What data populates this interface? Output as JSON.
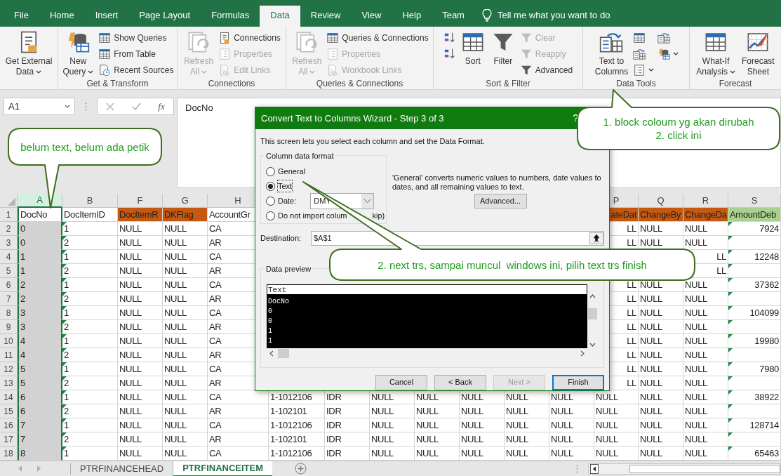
{
  "ribbon": {
    "tabs": [
      {
        "label": "File",
        "selected": false
      },
      {
        "label": "Home",
        "selected": false
      },
      {
        "label": "Insert",
        "selected": false
      },
      {
        "label": "Page Layout",
        "selected": false
      },
      {
        "label": "Formulas",
        "selected": false
      },
      {
        "label": "Data",
        "selected": true
      },
      {
        "label": "Review",
        "selected": false
      },
      {
        "label": "View",
        "selected": false
      },
      {
        "label": "Help",
        "selected": false
      },
      {
        "label": "Team",
        "selected": false
      }
    ],
    "tell_me": "Tell me what you want to do",
    "groups": [
      {
        "columns": [
          {
            "kind": "large",
            "lines": [
              "Get External",
              "Data"
            ],
            "dropdown": true,
            "disabled": false
          }
        ]
      },
      {
        "label": "Get & Transform",
        "columns": [
          {
            "kind": "large",
            "lines": [
              "New",
              "Query"
            ],
            "dropdown": true,
            "disabled": false
          },
          {
            "kind": "stack",
            "items": [
              {
                "label": "Show Queries",
                "disabled": false
              },
              {
                "label": "From Table",
                "disabled": false
              },
              {
                "label": "Recent Sources",
                "disabled": false
              }
            ]
          }
        ]
      },
      {
        "label": "Connections",
        "columns": [
          {
            "kind": "large",
            "lines": [
              "Refresh",
              "All"
            ],
            "dropdown": true,
            "disabled": true
          },
          {
            "kind": "stack",
            "items": [
              {
                "label": "Connections",
                "disabled": false
              },
              {
                "label": "Properties",
                "disabled": true
              },
              {
                "label": "Edit Links",
                "disabled": true
              }
            ]
          }
        ]
      },
      {
        "label": "Queries & Connections",
        "columns": [
          {
            "kind": "large",
            "lines": [
              "Refresh",
              "All"
            ],
            "dropdown": true,
            "disabled": true
          },
          {
            "kind": "stack",
            "items": [
              {
                "label": "Queries & Connections",
                "disabled": false
              },
              {
                "label": "Properties",
                "disabled": true
              },
              {
                "label": "Workbook Links",
                "disabled": true
              }
            ]
          }
        ]
      },
      {
        "label": "Sort & Filter",
        "columns": [
          {
            "kind": "stack",
            "items": [
              {
                "disabled": false
              },
              {
                "disabled": false
              }
            ]
          },
          {
            "kind": "large",
            "lines": [
              "Sort"
            ],
            "dropdown": false,
            "disabled": false
          },
          {
            "kind": "large",
            "lines": [
              "Filter"
            ],
            "dropdown": false,
            "disabled": false
          },
          {
            "kind": "stack",
            "items": [
              {
                "label": "Clear",
                "disabled": true
              },
              {
                "label": "Reapply",
                "disabled": true
              },
              {
                "label": "Advanced",
                "disabled": false
              }
            ]
          }
        ]
      },
      {
        "label": "Data Tools",
        "columns": [
          {
            "kind": "large",
            "lines": [
              "Text to",
              "Columns"
            ],
            "dropdown": false,
            "disabled": false
          },
          {
            "kind": "stack",
            "items": [
              {
                "disabled": false,
                "dropdown": false
              },
              {
                "disabled": false,
                "dropdown": false
              },
              {
                "disabled": false,
                "dropdown": true
              }
            ]
          },
          {
            "kind": "stack",
            "items": [
              {
                "disabled": false,
                "dropdown": false
              },
              {
                "disabled": false,
                "dropdown": true
              }
            ]
          }
        ]
      },
      {
        "label": "Forecast",
        "columns": [
          {
            "kind": "large",
            "lines": [
              "What-If",
              "Analysis"
            ],
            "dropdown": true,
            "disabled": false
          },
          {
            "kind": "large",
            "lines": [
              "Forecast",
              "Sheet"
            ],
            "dropdown": false,
            "disabled": false
          }
        ]
      }
    ]
  },
  "formula_bar": {
    "name_box": "A1",
    "fx": "fx",
    "value": "DocNo"
  },
  "grid": {
    "columns": [
      {
        "letter": "A",
        "selected": true
      },
      {
        "letter": "B",
        "selected": false,
        "flagged": true
      },
      {
        "letter": "F",
        "selected": false,
        "color": "#c65911"
      },
      {
        "letter": "G",
        "selected": false,
        "color": "#c65911"
      },
      {
        "letter": "H",
        "selected": false
      },
      {
        "selected": false
      },
      {
        "selected": false
      },
      {
        "selected": false
      },
      {
        "selected": false
      },
      {
        "selected": false
      },
      {
        "selected": false
      },
      {
        "selected": false
      },
      {
        "letter": "P",
        "selected": false,
        "color": "#c65911"
      },
      {
        "letter": "Q",
        "selected": false,
        "color": "#c65911"
      },
      {
        "letter": "R",
        "selected": false,
        "color": "#c65911"
      },
      {
        "letter": "S",
        "selected": false,
        "color": "#a9d08e",
        "flagged": true,
        "kind": "numeric"
      }
    ],
    "rows": [
      {
        "number": "1",
        "cells": [
          "DocNo",
          "DocItemID",
          "DocItemR",
          "DKFlag",
          "AccountGr",
          null,
          null,
          null,
          null,
          null,
          null,
          null,
          {
            "text": "ateDat",
            "kind": "clipped"
          },
          "ChangeBy",
          "ChangeDa",
          "AmountDeb"
        ]
      },
      {
        "number": "2",
        "cells": [
          "0",
          "1",
          "NULL",
          "NULL",
          "CA",
          null,
          null,
          null,
          null,
          null,
          null,
          null,
          {
            "text": "LL",
            "kind": "clipped"
          },
          "NULL",
          "NULL",
          "7924"
        ]
      },
      {
        "number": "3",
        "cells": [
          "0",
          "2",
          "NULL",
          "NULL",
          "AR",
          null,
          null,
          null,
          null,
          null,
          null,
          null,
          {
            "text": "LL",
            "kind": "clipped"
          },
          "NULL",
          "NULL",
          null
        ]
      },
      {
        "number": "4",
        "cells": [
          "1",
          "1",
          "NULL",
          "NULL",
          "CA",
          null,
          null,
          null,
          null,
          null,
          null,
          null,
          null,
          null,
          {
            "text": "LL",
            "kind": "clipped"
          },
          "12248"
        ]
      },
      {
        "number": "5",
        "cells": [
          "1",
          "2",
          "NULL",
          "NULL",
          "AR",
          null,
          null,
          null,
          null,
          null,
          null,
          null,
          null,
          null,
          {
            "text": "LL",
            "kind": "clipped"
          },
          null
        ]
      },
      {
        "number": "6",
        "cells": [
          "2",
          "1",
          "NULL",
          "NULL",
          "CA",
          null,
          null,
          null,
          null,
          null,
          null,
          null,
          {
            "text": "LL",
            "kind": "clipped"
          },
          "NULL",
          "NULL",
          "37362"
        ]
      },
      {
        "number": "7",
        "cells": [
          "2",
          "2",
          "NULL",
          "NULL",
          "AR",
          null,
          null,
          null,
          null,
          null,
          null,
          null,
          {
            "text": "LL",
            "kind": "clipped"
          },
          "NULL",
          "NULL",
          null
        ]
      },
      {
        "number": "8",
        "cells": [
          "3",
          "1",
          "NULL",
          "NULL",
          "CA",
          null,
          null,
          null,
          null,
          null,
          null,
          null,
          {
            "text": "LL",
            "kind": "clipped"
          },
          "NULL",
          "NULL",
          "104099"
        ]
      },
      {
        "number": "9",
        "cells": [
          "3",
          "2",
          "NULL",
          "NULL",
          "AR",
          null,
          null,
          null,
          null,
          null,
          null,
          null,
          {
            "text": "LL",
            "kind": "clipped"
          },
          "NULL",
          "NULL",
          null
        ]
      },
      {
        "number": "10",
        "cells": [
          "4",
          "1",
          "NULL",
          "NULL",
          "CA",
          null,
          null,
          null,
          null,
          null,
          null,
          null,
          {
            "text": "LL",
            "kind": "clipped"
          },
          "NULL",
          "NULL",
          "19980"
        ]
      },
      {
        "number": "11",
        "cells": [
          "4",
          "2",
          "NULL",
          "NULL",
          "AR",
          null,
          null,
          null,
          null,
          null,
          null,
          null,
          {
            "text": "LL",
            "kind": "clipped"
          },
          "NULL",
          "NULL",
          null
        ]
      },
      {
        "number": "12",
        "cells": [
          "5",
          "1",
          "NULL",
          "NULL",
          "CA",
          null,
          null,
          null,
          null,
          null,
          null,
          null,
          {
            "text": "LL",
            "kind": "clipped"
          },
          "NULL",
          "NULL",
          "7980"
        ]
      },
      {
        "number": "13",
        "cells": [
          "5",
          "2",
          "NULL",
          "NULL",
          "AR",
          null,
          null,
          null,
          null,
          null,
          null,
          null,
          {
            "text": "LL",
            "kind": "clipped"
          },
          "NULL",
          "NULL",
          null
        ]
      },
      {
        "number": "14",
        "cells": [
          "6",
          "1",
          "NULL",
          "NULL",
          "CA",
          "1-1012106",
          "IDR",
          "NULL",
          "NULL",
          "NULL",
          "NULL",
          "NULL",
          "NULL",
          "NULL",
          "NULL",
          "38922"
        ]
      },
      {
        "number": "15",
        "cells": [
          "6",
          "2",
          "NULL",
          "NULL",
          "AR",
          "1-102101",
          "IDR",
          "NULL",
          "NULL",
          "NULL",
          "NULL",
          "NULL",
          "NULL",
          "NULL",
          "NULL",
          null
        ]
      },
      {
        "number": "16",
        "cells": [
          "7",
          "1",
          "NULL",
          "NULL",
          "CA",
          "1-1012106",
          "IDR",
          "NULL",
          "NULL",
          "NULL",
          "NULL",
          "NULL",
          "NULL",
          "NULL",
          "NULL",
          "128714"
        ]
      },
      {
        "number": "17",
        "cells": [
          "7",
          "2",
          "NULL",
          "NULL",
          "AR",
          "1-102101",
          "IDR",
          "NULL",
          "NULL",
          "NULL",
          "NULL",
          "NULL",
          "NULL",
          "NULL",
          "NULL",
          null
        ]
      },
      {
        "number": "18",
        "cells": [
          "8",
          "1",
          "NULL",
          "NULL",
          "CA",
          "1-1012106",
          "IDR",
          "NULL",
          "NULL",
          "NULL",
          "NULL",
          "NULL",
          "NULL",
          "NULL",
          "NULL",
          "65463"
        ]
      }
    ]
  },
  "sheet_tabs": [
    {
      "label": "PTRFINANCEHEAD",
      "selected": false
    },
    {
      "label": "PTRFINANCEITEM",
      "selected": true
    }
  ],
  "dialog": {
    "title": "Convert Text to Columns Wizard - Step 3 of 3",
    "help": "?",
    "intro": "This screen lets you select each column and set the Data Format.",
    "format": {
      "label": "Column data format",
      "options": [
        {
          "label": "General",
          "selected": false
        },
        {
          "label": "Text",
          "selected": true
        },
        {
          "label": "Date:",
          "selected": false,
          "kind": "date"
        },
        {
          "label": "Do not import colum",
          "rest": "kip)",
          "selected": false
        }
      ],
      "date_value": "DMY"
    },
    "description": "'General' converts numeric values to numbers, date values to dates, and all remaining values to text.",
    "advanced": "Advanced...",
    "destination": {
      "label": "Destination:",
      "value": "$A$1"
    },
    "preview": {
      "label": "Data preview",
      "header": "Text",
      "lines": [
        "DocNo",
        "0",
        "0",
        "1",
        "1"
      ]
    },
    "buttons": [
      {
        "label": "Cancel",
        "disabled": false,
        "default": false
      },
      {
        "label": "< Back",
        "disabled": false,
        "default": false
      },
      {
        "label": "Next >",
        "disabled": true,
        "default": false
      },
      {
        "label": "Finish",
        "disabled": false,
        "default": true
      }
    ]
  },
  "callouts": [
    {
      "lines": [
        "belum text, belum ada petik"
      ]
    },
    {
      "lines": [
        "1. block coloum yg akan dirubah",
        "2. click ini"
      ]
    },
    {
      "lines": [
        "2. next trs, sampai muncul  windows ini, pilih text trs finish"
      ]
    }
  ]
}
